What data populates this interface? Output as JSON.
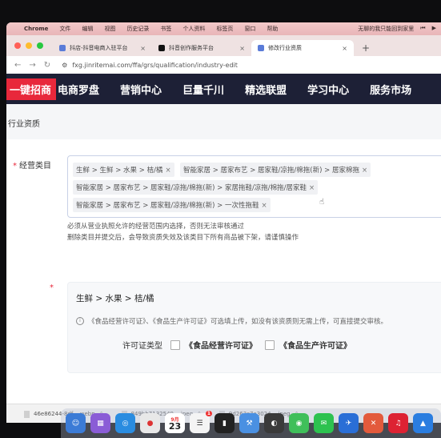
{
  "menubar": {
    "app_name": "Chrome",
    "items": [
      "文件",
      "编辑",
      "视图",
      "历史记录",
      "书签",
      "个人资料",
      "标签页",
      "窗口",
      "帮助"
    ],
    "right_text": "无聊的我只能回到家里"
  },
  "tabs": [
    {
      "title": "抖店-抖音电商入驻平台",
      "active": false,
      "favicon_color": "#5a7bd8"
    },
    {
      "title": "抖音创作服务平台",
      "active": false,
      "favicon_color": "#111111"
    },
    {
      "title": "修改行业资质",
      "active": true,
      "favicon_color": "#5a7bd8"
    }
  ],
  "url": "fxg.jinritemai.com/ffa/grs/qualification/industry-edit",
  "site_nav": [
    "一键招商",
    "电商罗盘",
    "营销中心",
    "巨量千川",
    "精选联盟",
    "学习中心",
    "服务市场"
  ],
  "page_title": "行业资质",
  "category": {
    "label": "经营类目",
    "tags": [
      "生鲜 > 生鲜 > 水果 > 桔/橘",
      "智能家居 > 居家布艺 > 居家鞋/凉拖/棉拖(新) > 居家棉拖",
      "智能家居 > 居家布艺 > 居家鞋/凉拖/棉拖(新) > 家居拖鞋/凉拖/棉拖/居家鞋",
      "智能家居 > 居家布艺 > 居家鞋/凉拖/棉拖(新) > 一次性拖鞋"
    ],
    "close_glyph": "×",
    "notes": [
      "必须从营业执照允许的经营范围内选择，否则无法审核通过",
      "删除类目并提交后，会导致资质失效及该类目下所有商品被下架，请谨慎操作"
    ]
  },
  "qualification": {
    "title": "生鲜 > 水果 > 桔/橘",
    "info": "《食品经营许可证》、《食品生产许可证》可选填上传，如没有该资质则无需上传，可直接提交审核。",
    "permit_label": "许可证类型",
    "options": [
      "《食品经营许可证》",
      "《食品生产许可证》"
    ]
  },
  "downloads": [
    "46e86244-8df....webp",
    "849bb7132549....jpeg",
    "9d263c7a3024....jpeg"
  ],
  "dock": {
    "calendar_month": "9月",
    "calendar_day": "23",
    "badge": "1"
  },
  "colors": {
    "nav_bg": "#1d2036",
    "accent_red": "#e8283b",
    "menubar_pink": "#f3c9c9"
  }
}
